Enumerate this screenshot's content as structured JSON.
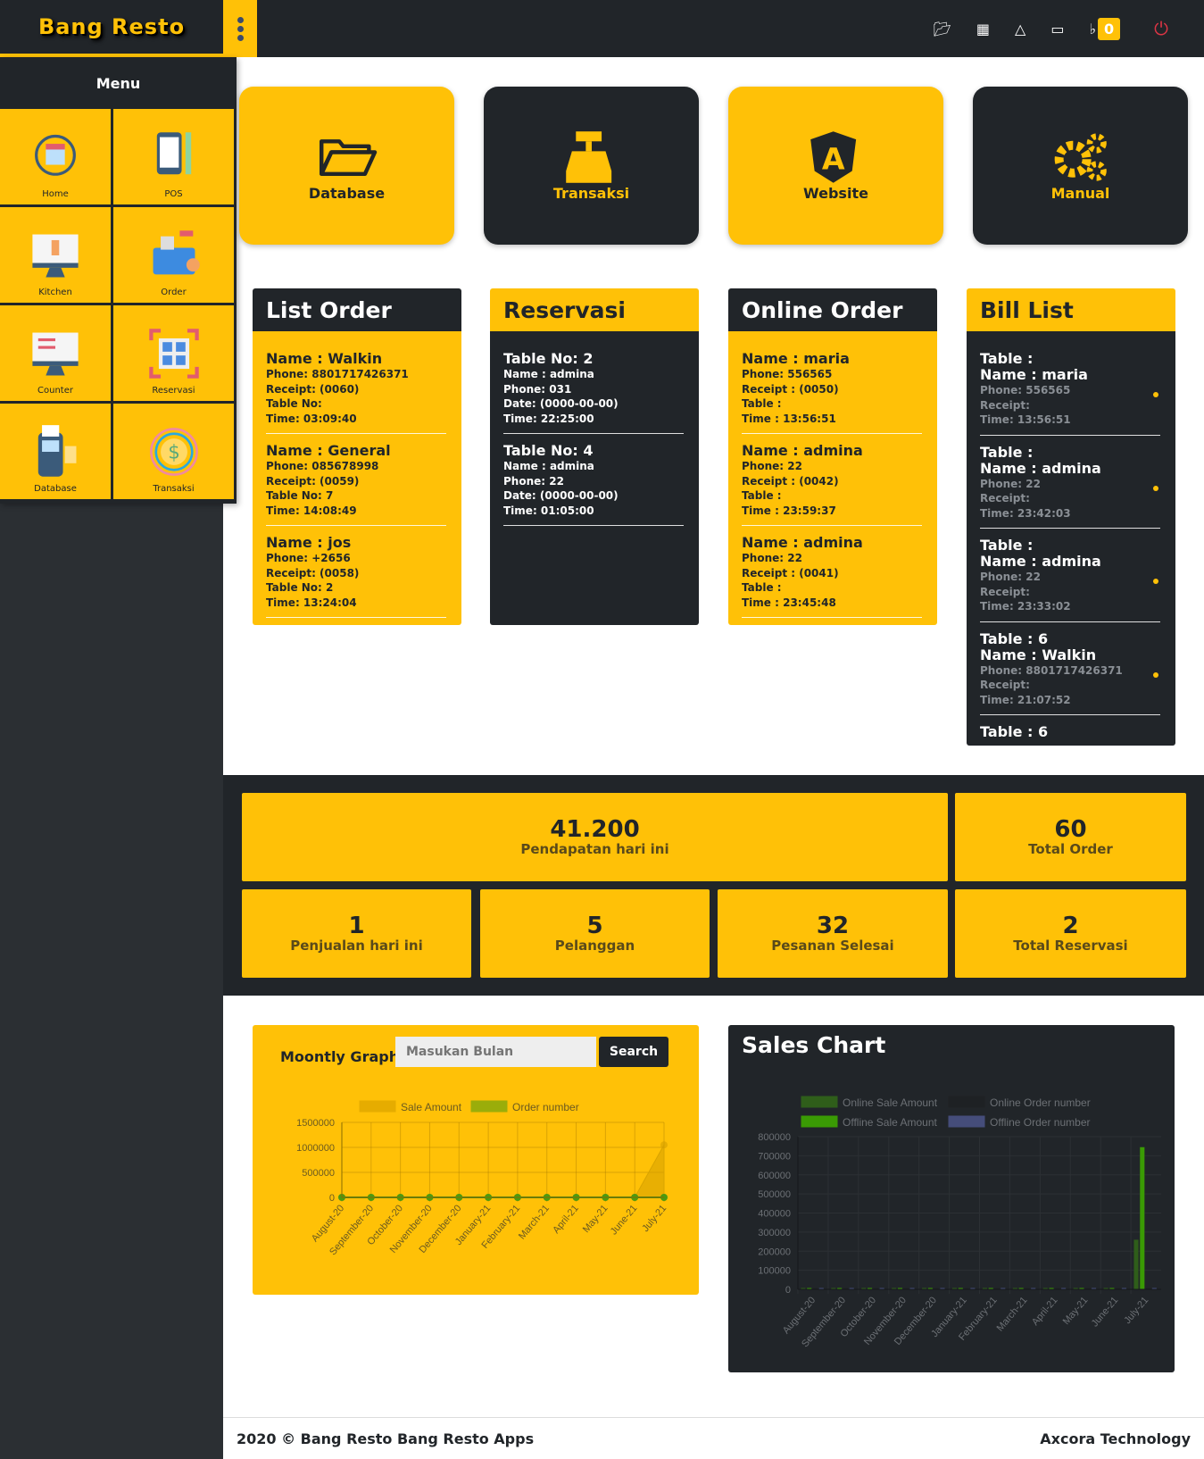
{
  "header": {
    "logo": "Bang Resto",
    "notification_count": "0",
    "icons": [
      "folder-open-icon",
      "cash-register-icon",
      "angular-icon",
      "desktop-icon",
      "bell-icon",
      "power-icon"
    ]
  },
  "sidebar": {
    "title": "Menu",
    "items": [
      {
        "label": "Home"
      },
      {
        "label": "POS"
      },
      {
        "label": "Kitchen"
      },
      {
        "label": "Order"
      },
      {
        "label": "Counter"
      },
      {
        "label": "Reservasi"
      },
      {
        "label": "Database"
      },
      {
        "label": "Transaksi"
      }
    ]
  },
  "shortcuts": [
    {
      "label": "Database",
      "icon": "folder-open-icon"
    },
    {
      "label": "Transaksi",
      "icon": "cash-register-icon"
    },
    {
      "label": "Website",
      "icon": "angular-icon"
    },
    {
      "label": "Manual",
      "icon": "gears-icon"
    }
  ],
  "list_order": {
    "title": "List Order",
    "items": [
      {
        "name": "Name : Walkin",
        "phone": "Phone: 8801717426371",
        "receipt": "Receipt: (0060)",
        "table": "Table No:",
        "time": "Time: 03:09:40"
      },
      {
        "name": "Name : General",
        "phone": "Phone: 085678998",
        "receipt": "Receipt: (0059)",
        "table": "Table No: 7",
        "time": "Time: 14:08:49"
      },
      {
        "name": "Name : jos",
        "phone": "Phone: +2656",
        "receipt": "Receipt: (0058)",
        "table": "Table No: 2",
        "time": "Time: 13:24:04"
      }
    ]
  },
  "reservasi": {
    "title": "Reservasi",
    "items": [
      {
        "table": "Table No: 2",
        "name": "Name : admina",
        "phone": "Phone: 031",
        "date": "Date: (0000-00-00)",
        "time": "Time: 22:25:00"
      },
      {
        "table": "Table No: 4",
        "name": "Name : admina",
        "phone": "Phone: 22",
        "date": "Date: (0000-00-00)",
        "time": "Time: 01:05:00"
      }
    ]
  },
  "online_order": {
    "title": "Online Order",
    "items": [
      {
        "name": "Name : maria",
        "phone": "Phone: 556565",
        "receipt": "Receipt : (0050)",
        "table": "Table :",
        "time": "Time : 13:56:51"
      },
      {
        "name": "Name : admina",
        "phone": "Phone: 22",
        "receipt": "Receipt : (0042)",
        "table": "Table :",
        "time": "Time : 23:59:37"
      },
      {
        "name": "Name : admina",
        "phone": "Phone: 22",
        "receipt": "Receipt : (0041)",
        "table": "Table :",
        "time": "Time : 23:45:48"
      }
    ]
  },
  "bill_list": {
    "title": "Bill List",
    "items": [
      {
        "table": "Table :",
        "name": "Name : maria",
        "phone": "Phone: 556565",
        "receipt": "Receipt:",
        "time": "Time: 13:56:51"
      },
      {
        "table": "Table :",
        "name": "Name : admina",
        "phone": "Phone: 22",
        "receipt": "Receipt:",
        "time": "Time: 23:42:03"
      },
      {
        "table": "Table :",
        "name": "Name : admina",
        "phone": "Phone: 22",
        "receipt": "Receipt:",
        "time": "Time: 23:33:02"
      },
      {
        "table": "Table : 6",
        "name": "Name : Walkin",
        "phone": "Phone: 8801717426371",
        "receipt": "Receipt:",
        "time": "Time: 21:07:52"
      },
      {
        "table": "Table : 6"
      }
    ]
  },
  "stats": [
    {
      "value": "41.200",
      "label": "Pendapatan hari ini"
    },
    {
      "value": "60",
      "label": "Total Order"
    },
    {
      "value": "1",
      "label": "Penjualan hari ini"
    },
    {
      "value": "5",
      "label": "Pelanggan"
    },
    {
      "value": "32",
      "label": "Pesanan Selesai"
    },
    {
      "value": "2",
      "label": "Total Reservasi"
    }
  ],
  "monthly": {
    "title": "Moontly Graph",
    "search_placeholder": "Masukan Bulan",
    "search_label": "Search"
  },
  "chart_data": [
    {
      "type": "line",
      "title": "",
      "categories": [
        "August-20",
        "September-20",
        "October-20",
        "November-20",
        "December-20",
        "January-21",
        "February-21",
        "March-21",
        "April-21",
        "May-21",
        "June-21",
        "July-21"
      ],
      "series": [
        {
          "name": "Sale Amount",
          "color": "#e6ac00",
          "values": [
            0,
            0,
            0,
            0,
            0,
            0,
            0,
            0,
            0,
            0,
            0,
            1050000
          ]
        },
        {
          "name": "Order number",
          "color": "#9aad0a",
          "values": [
            0,
            0,
            0,
            0,
            0,
            0,
            0,
            0,
            0,
            0,
            0,
            1
          ]
        }
      ],
      "ylim": [
        0,
        1500000
      ],
      "yticks": [
        0,
        500000,
        1000000,
        1500000
      ],
      "grid": true,
      "legend": "top"
    },
    {
      "type": "bar",
      "title": "Sales Chart",
      "categories": [
        "August-20",
        "September-20",
        "October-20",
        "November-20",
        "December-20",
        "January-21",
        "February-21",
        "March-21",
        "April-21",
        "May-21",
        "June-21",
        "July-21"
      ],
      "series": [
        {
          "name": "Online Sale Amount",
          "color": "#2f5e1a",
          "values": [
            0,
            0,
            0,
            0,
            0,
            0,
            0,
            0,
            0,
            0,
            0,
            260000
          ]
        },
        {
          "name": "Online Order number",
          "color": "#1e2124",
          "values": [
            0,
            0,
            0,
            0,
            0,
            0,
            0,
            0,
            0,
            0,
            0,
            0
          ]
        },
        {
          "name": "Offline Sale Amount",
          "color": "#3a9a04",
          "values": [
            0,
            0,
            0,
            0,
            0,
            0,
            0,
            0,
            0,
            0,
            0,
            745000
          ]
        },
        {
          "name": "Offline Order number",
          "color": "#454d7a",
          "values": [
            0,
            0,
            0,
            0,
            0,
            0,
            0,
            0,
            0,
            0,
            0,
            0
          ]
        }
      ],
      "ylim": [
        0,
        800000
      ],
      "yticks": [
        0,
        100000,
        200000,
        300000,
        400000,
        500000,
        600000,
        700000,
        800000
      ],
      "grid": true,
      "legend": "top"
    }
  ],
  "footer": {
    "left": "2020 © Bang Resto Bang Resto Apps",
    "right": "Axcora Technology"
  }
}
